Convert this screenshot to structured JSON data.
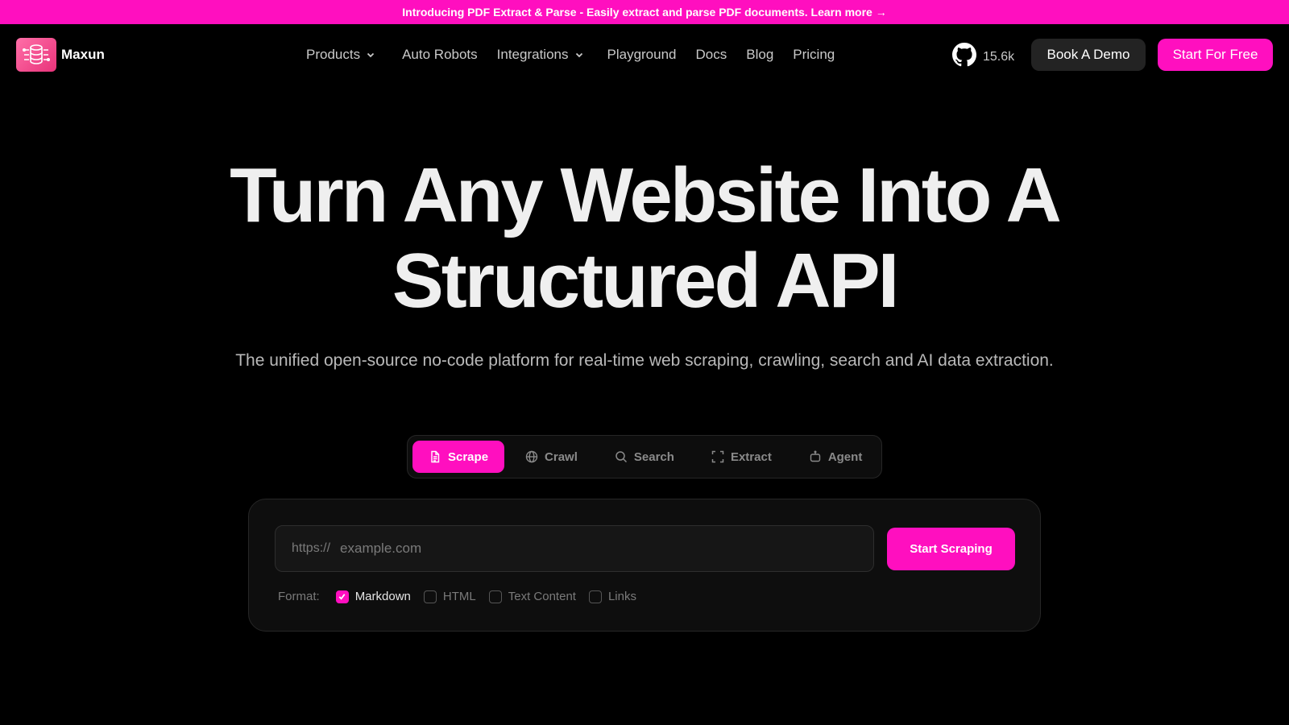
{
  "announcement": "Introducing PDF Extract & Parse - Easily extract and parse PDF documents. Learn more →",
  "brand": {
    "name": "Maxun",
    "accent": "#ff0fbf"
  },
  "nav": {
    "items": [
      {
        "label": "Products",
        "dropdown": true
      },
      {
        "label": "Auto Robots",
        "dropdown": false
      },
      {
        "label": "Integrations",
        "dropdown": true
      },
      {
        "label": "Playground",
        "dropdown": false
      },
      {
        "label": "Docs",
        "dropdown": false
      },
      {
        "label": "Blog",
        "dropdown": false
      },
      {
        "label": "Pricing",
        "dropdown": false
      }
    ],
    "github_stars": "15.6k",
    "demo_label": "Book A Demo",
    "free_label": "Start For Free"
  },
  "hero": {
    "title_line1": "Turn Any Website Into A",
    "title_line2": "Structured API",
    "subtitle": "The unified open-source no-code platform for real-time web scraping, crawling, search and AI data extraction."
  },
  "tabs": [
    {
      "label": "Scrape",
      "icon": "file-icon",
      "active": true
    },
    {
      "label": "Crawl",
      "icon": "globe-icon",
      "active": false
    },
    {
      "label": "Search",
      "icon": "search-icon",
      "active": false
    },
    {
      "label": "Extract",
      "icon": "scan-icon",
      "active": false
    },
    {
      "label": "Agent",
      "icon": "robot-icon",
      "active": false
    }
  ],
  "scrape": {
    "prefix": "https://",
    "placeholder": "example.com",
    "button_label": "Start Scraping",
    "format_label": "Format:",
    "formats": [
      {
        "label": "Markdown",
        "checked": true
      },
      {
        "label": "HTML",
        "checked": false
      },
      {
        "label": "Text Content",
        "checked": false
      },
      {
        "label": "Links",
        "checked": false
      }
    ]
  }
}
